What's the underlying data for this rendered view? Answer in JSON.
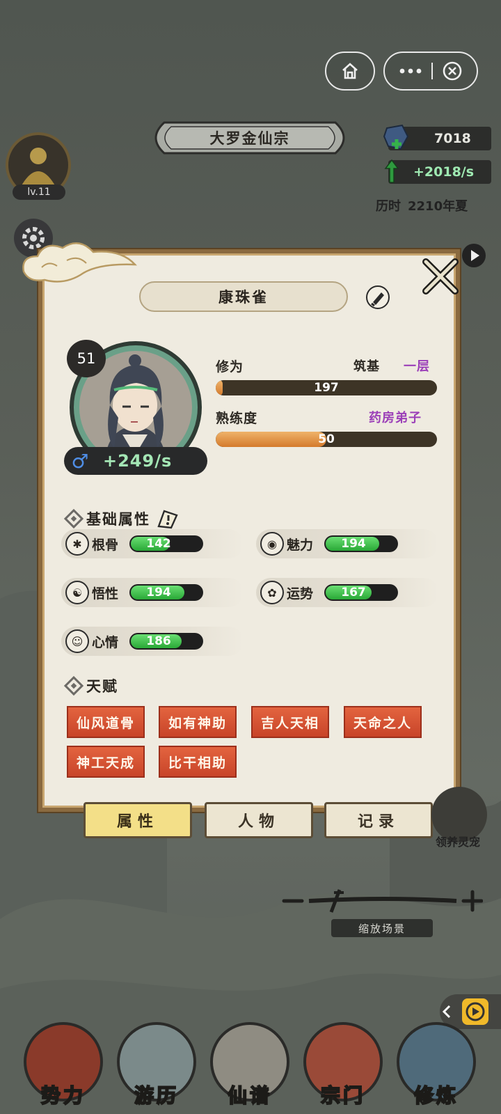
{
  "capsule": {
    "home_icon": "home-icon",
    "more_icon": "more-icon",
    "close_icon": "close-circle-icon"
  },
  "header": {
    "sect_name": "大罗金仙宗",
    "spirit_stones": "7018",
    "income_rate": "+2018/s",
    "time_label": "历时",
    "time_value": "2210年夏",
    "player_level": "lv.11"
  },
  "character": {
    "name": "康珠雀",
    "age": "51",
    "gender_symbol": "♂",
    "cultivation_rate": "+249/s",
    "stats": [
      {
        "label": "修为",
        "realm": "筑基",
        "stage": "一层",
        "value": "197",
        "fill": 0.02
      },
      {
        "label": "熟练度",
        "rank": "药房弟子",
        "value": "50",
        "fill": 0.5
      }
    ]
  },
  "attributes": {
    "title": "基础属性",
    "items": [
      {
        "label": "根骨",
        "value": "142",
        "icon": "bone-icon",
        "fill": 0.55
      },
      {
        "label": "魅力",
        "value": "194",
        "icon": "charm-icon",
        "fill": 0.75
      },
      {
        "label": "悟性",
        "value": "194",
        "icon": "meditation-icon",
        "fill": 0.75
      },
      {
        "label": "运势",
        "value": "167",
        "icon": "clover-icon",
        "fill": 0.65
      },
      {
        "label": "心情",
        "value": "186",
        "icon": "mood-icon",
        "fill": 0.72
      }
    ]
  },
  "talents": {
    "title": "天赋",
    "items": [
      "仙风道骨",
      "如有神助",
      "吉人天相",
      "天命之人",
      "神工天成",
      "比干相助"
    ]
  },
  "tabs": [
    "属性",
    "人物",
    "记录"
  ],
  "side": {
    "pet_label": "领养灵宠"
  },
  "zoom": {
    "label": "缩放场景"
  },
  "bottom_nav": [
    "势力",
    "游历",
    "仙谱",
    "宗门",
    "修炼"
  ],
  "colors": {
    "talent": "#d6533a",
    "bar_orange": "#e59a4c",
    "attr_green": "#3cc04a",
    "tab_active": "#f3df88"
  }
}
